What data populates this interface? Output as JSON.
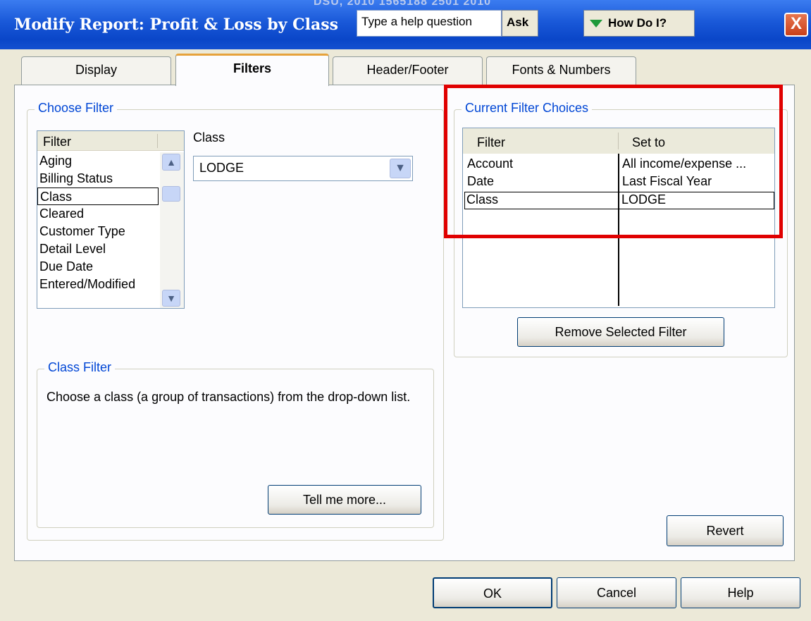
{
  "window": {
    "title_clip": "DSU, 2010 1565188 2501 2010",
    "title": "Modify Report: Profit & Loss by Class",
    "help_question_placeholder": "Type a help question",
    "ask_label": "Ask",
    "how_do_i_label": "How Do I?",
    "close_label": "X"
  },
  "tabs": [
    {
      "label": "Display"
    },
    {
      "label": "Filters"
    },
    {
      "label": "Header/Footer"
    },
    {
      "label": "Fonts & Numbers"
    }
  ],
  "choose_filter": {
    "group_label": "Choose Filter",
    "list_header": "Filter",
    "items": [
      "Aging",
      "Billing Status",
      "Class",
      "Cleared",
      "Customer Type",
      "Detail Level",
      "Due Date",
      "Entered/Modified"
    ],
    "selected_index": 2,
    "class_label": "Class",
    "class_value": "LODGE"
  },
  "class_filter": {
    "group_label": "Class Filter",
    "description": "Choose a class (a group of transactions) from the drop-down list.",
    "tell_me_more_label": "Tell me more..."
  },
  "current_filters": {
    "group_label": "Current Filter Choices",
    "col_filter": "Filter",
    "col_set_to": "Set to",
    "rows": [
      {
        "filter": "Account",
        "set_to": "All income/expense ..."
      },
      {
        "filter": "Date",
        "set_to": "Last Fiscal Year"
      },
      {
        "filter": "Class",
        "set_to": "LODGE"
      }
    ],
    "selected_index": 2,
    "remove_label": "Remove Selected Filter"
  },
  "buttons": {
    "revert": "Revert",
    "ok": "OK",
    "cancel": "Cancel",
    "help": "Help"
  },
  "colors": {
    "titlebar": "#0a46c8",
    "highlight_box": "#e00000",
    "group_label": "#0046d5",
    "active_tab_accent": "#e6a23c"
  }
}
